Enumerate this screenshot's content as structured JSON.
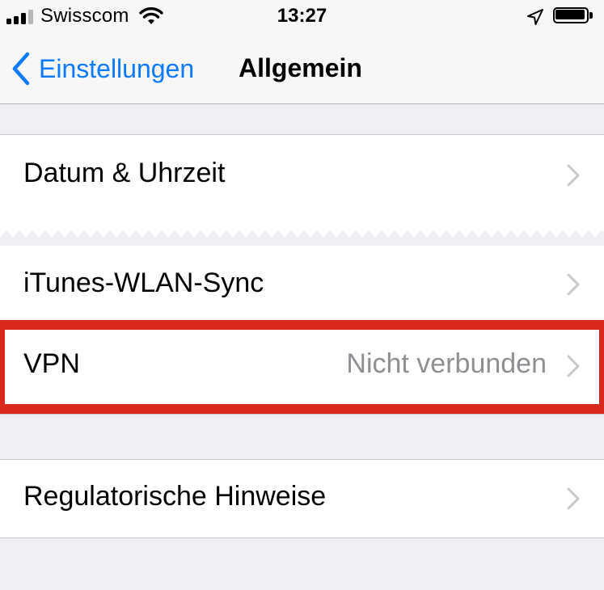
{
  "status_bar": {
    "carrier": "Swisscom",
    "time": "13:27",
    "signal_bars_filled": 3,
    "signal_bars_total": 4,
    "icons": [
      "signal-bars-icon",
      "wifi-icon",
      "location-arrow-icon",
      "battery-icon"
    ]
  },
  "nav": {
    "back_label": "Einstellungen",
    "back_icon": "chevron-left-icon",
    "title": "Allgemein",
    "accent_color": "#0a7aff"
  },
  "cells": {
    "date_time": {
      "label": "Datum & Uhrzeit"
    },
    "itunes_sync": {
      "label": "iTunes-WLAN-Sync"
    },
    "vpn": {
      "label": "VPN",
      "value": "Nicht verbunden"
    },
    "regulatory": {
      "label": "Regulatorische Hinweise"
    }
  },
  "highlight": {
    "target": "vpn",
    "color": "#d9291c"
  }
}
